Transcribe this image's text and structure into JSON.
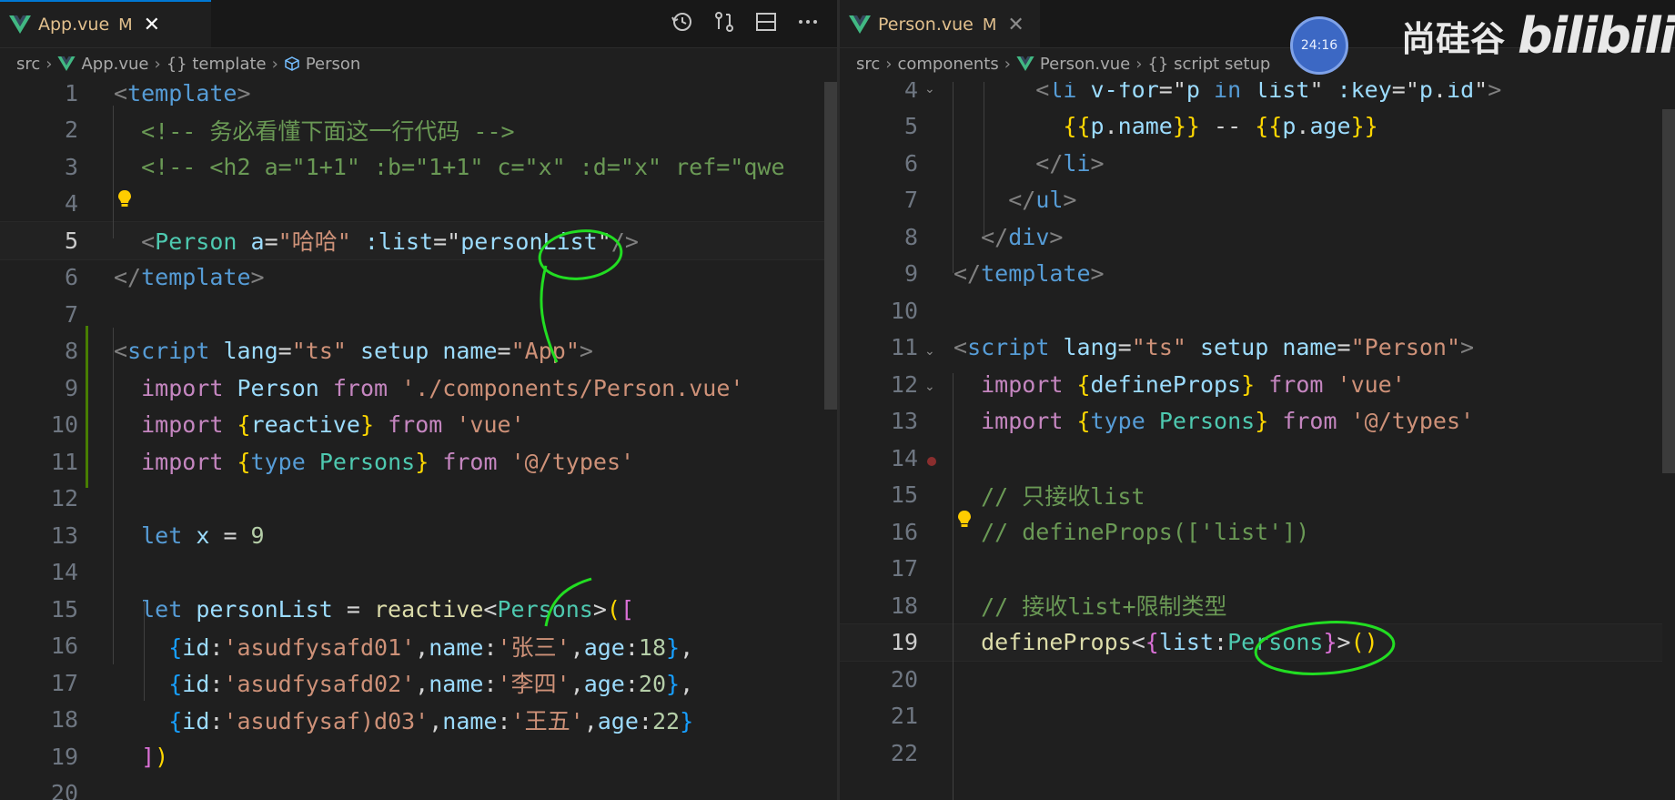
{
  "left": {
    "tab": {
      "name": "App.vue",
      "status": "M",
      "close": "✕"
    },
    "breadcrumb": [
      "src",
      "App.vue",
      "{} template",
      "Person"
    ],
    "lines": [
      {
        "n": "1",
        "tokens": [
          [
            "t-p",
            "<"
          ],
          [
            "t-tag",
            "template"
          ],
          [
            "t-p",
            ">"
          ]
        ]
      },
      {
        "n": "2",
        "tokens": [
          [
            "t-cmt",
            "  <!-- 务必看懂下面这一行代码 -->"
          ]
        ]
      },
      {
        "n": "3",
        "tokens": [
          [
            "t-cmt",
            "  <!-- <h2 a=\"1+1\" :b=\"1+1\" c=\"x\" :d=\"x\" ref=\"qwe"
          ]
        ]
      },
      {
        "n": "4",
        "tokens": []
      },
      {
        "n": "5",
        "tokens": [
          [
            "t-p",
            "  <"
          ],
          [
            "t-comp",
            "Person"
          ],
          [
            "t-op",
            " "
          ],
          [
            "t-attr",
            "a"
          ],
          [
            "t-op",
            "="
          ],
          [
            "t-str",
            "\"哈哈\""
          ],
          [
            "t-op",
            " "
          ],
          [
            "t-attr",
            ":list"
          ],
          [
            "t-op",
            "="
          ],
          [
            "t-op",
            "\""
          ],
          [
            "t-var",
            "personList"
          ],
          [
            "t-op",
            "\""
          ],
          [
            "t-p",
            "/>"
          ]
        ]
      },
      {
        "n": "6",
        "tokens": [
          [
            "t-p",
            "</"
          ],
          [
            "t-tag",
            "template"
          ],
          [
            "t-p",
            ">"
          ]
        ]
      },
      {
        "n": "7",
        "tokens": []
      },
      {
        "n": "8",
        "tokens": [
          [
            "t-p",
            "<"
          ],
          [
            "t-tag",
            "script"
          ],
          [
            "t-op",
            " "
          ],
          [
            "t-attr",
            "lang"
          ],
          [
            "t-op",
            "="
          ],
          [
            "t-str",
            "\"ts\""
          ],
          [
            "t-op",
            " "
          ],
          [
            "t-attr",
            "setup"
          ],
          [
            "t-op",
            " "
          ],
          [
            "t-attr",
            "name"
          ],
          [
            "t-op",
            "="
          ],
          [
            "t-str",
            "\"App\""
          ],
          [
            "t-p",
            ">"
          ]
        ]
      },
      {
        "n": "9",
        "tokens": [
          [
            "t-kw",
            "  import"
          ],
          [
            "t-op",
            " "
          ],
          [
            "t-var",
            "Person"
          ],
          [
            "t-op",
            " "
          ],
          [
            "t-kw",
            "from"
          ],
          [
            "t-op",
            " "
          ],
          [
            "t-str",
            "'./components/Person.vue'"
          ]
        ]
      },
      {
        "n": "10",
        "tokens": [
          [
            "t-kw",
            "  import"
          ],
          [
            "t-op",
            " "
          ],
          [
            "t-b1",
            "{"
          ],
          [
            "t-var",
            "reactive"
          ],
          [
            "t-b1",
            "}"
          ],
          [
            "t-op",
            " "
          ],
          [
            "t-kw",
            "from"
          ],
          [
            "t-op",
            " "
          ],
          [
            "t-str",
            "'vue'"
          ]
        ]
      },
      {
        "n": "11",
        "tokens": [
          [
            "t-kw",
            "  import"
          ],
          [
            "t-op",
            " "
          ],
          [
            "t-b1",
            "{"
          ],
          [
            "t-bkw",
            "type"
          ],
          [
            "t-op",
            " "
          ],
          [
            "t-type",
            "Persons"
          ],
          [
            "t-b1",
            "}"
          ],
          [
            "t-op",
            " "
          ],
          [
            "t-kw",
            "from"
          ],
          [
            "t-op",
            " "
          ],
          [
            "t-str",
            "'@/types'"
          ]
        ]
      },
      {
        "n": "12",
        "tokens": []
      },
      {
        "n": "13",
        "tokens": [
          [
            "t-bkw",
            "  let"
          ],
          [
            "t-op",
            " "
          ],
          [
            "t-var",
            "x"
          ],
          [
            "t-op",
            " = "
          ],
          [
            "t-num",
            "9"
          ]
        ]
      },
      {
        "n": "14",
        "tokens": []
      },
      {
        "n": "15",
        "tokens": [
          [
            "t-bkw",
            "  let"
          ],
          [
            "t-op",
            " "
          ],
          [
            "t-var",
            "personList"
          ],
          [
            "t-op",
            " = "
          ],
          [
            "t-fn",
            "reactive"
          ],
          [
            "t-op",
            "<"
          ],
          [
            "t-type",
            "Persons"
          ],
          [
            "t-op",
            ">"
          ],
          [
            "t-b1",
            "("
          ],
          [
            "t-b2",
            "["
          ]
        ]
      },
      {
        "n": "16",
        "tokens": [
          [
            "t-op",
            "    "
          ],
          [
            "t-b3",
            "{"
          ],
          [
            "t-var",
            "id"
          ],
          [
            "t-op",
            ":"
          ],
          [
            "t-str",
            "'asudfysafd01'"
          ],
          [
            "t-op",
            ","
          ],
          [
            "t-var",
            "name"
          ],
          [
            "t-op",
            ":"
          ],
          [
            "t-str",
            "'张三'"
          ],
          [
            "t-op",
            ","
          ],
          [
            "t-var",
            "age"
          ],
          [
            "t-op",
            ":"
          ],
          [
            "t-num",
            "18"
          ],
          [
            "t-b3",
            "}"
          ],
          [
            "t-op",
            ","
          ]
        ]
      },
      {
        "n": "17",
        "tokens": [
          [
            "t-op",
            "    "
          ],
          [
            "t-b3",
            "{"
          ],
          [
            "t-var",
            "id"
          ],
          [
            "t-op",
            ":"
          ],
          [
            "t-str",
            "'asudfysafd02'"
          ],
          [
            "t-op",
            ","
          ],
          [
            "t-var",
            "name"
          ],
          [
            "t-op",
            ":"
          ],
          [
            "t-str",
            "'李四'"
          ],
          [
            "t-op",
            ","
          ],
          [
            "t-var",
            "age"
          ],
          [
            "t-op",
            ":"
          ],
          [
            "t-num",
            "20"
          ],
          [
            "t-b3",
            "}"
          ],
          [
            "t-op",
            ","
          ]
        ]
      },
      {
        "n": "18",
        "tokens": [
          [
            "t-op",
            "    "
          ],
          [
            "t-b3",
            "{"
          ],
          [
            "t-var",
            "id"
          ],
          [
            "t-op",
            ":"
          ],
          [
            "t-str",
            "'asudfysaf)d03'"
          ],
          [
            "t-op",
            ","
          ],
          [
            "t-var",
            "name"
          ],
          [
            "t-op",
            ":"
          ],
          [
            "t-str",
            "'王五'"
          ],
          [
            "t-op",
            ","
          ],
          [
            "t-var",
            "age"
          ],
          [
            "t-op",
            ":"
          ],
          [
            "t-num",
            "22"
          ],
          [
            "t-b3",
            "}"
          ]
        ]
      },
      {
        "n": "19",
        "tokens": [
          [
            "t-op",
            "  "
          ],
          [
            "t-b2",
            "]"
          ],
          [
            "t-b1",
            ")"
          ]
        ]
      },
      {
        "n": "20",
        "tokens": []
      }
    ]
  },
  "right": {
    "tab": {
      "name": "Person.vue",
      "status": "M",
      "close": "✕"
    },
    "breadcrumb": [
      "src",
      "components",
      "Person.vue",
      "{} script setup"
    ],
    "lines": [
      {
        "n": "4",
        "tokens": [
          [
            "t-p",
            "      <"
          ],
          [
            "t-tag",
            "li"
          ],
          [
            "t-op",
            " "
          ],
          [
            "t-attr",
            "v-for"
          ],
          [
            "t-op",
            "="
          ],
          [
            "t-op",
            "\""
          ],
          [
            "t-var",
            "p"
          ],
          [
            "t-op",
            " "
          ],
          [
            "t-bkw",
            "in"
          ],
          [
            "t-op",
            " "
          ],
          [
            "t-var",
            "list"
          ],
          [
            "t-op",
            "\""
          ],
          [
            "t-op",
            " "
          ],
          [
            "t-attr",
            ":key"
          ],
          [
            "t-op",
            "="
          ],
          [
            "t-op",
            "\""
          ],
          [
            "t-var",
            "p"
          ],
          [
            "t-op",
            "."
          ],
          [
            "t-var",
            "id"
          ],
          [
            "t-op",
            "\""
          ],
          [
            "t-p",
            ">"
          ]
        ]
      },
      {
        "n": "5",
        "tokens": [
          [
            "t-op",
            "        "
          ],
          [
            "t-b1",
            "{{"
          ],
          [
            "t-var",
            "p"
          ],
          [
            "t-op",
            "."
          ],
          [
            "t-var",
            "name"
          ],
          [
            "t-b1",
            "}}"
          ],
          [
            "t-op",
            " -- "
          ],
          [
            "t-b1",
            "{{"
          ],
          [
            "t-var",
            "p"
          ],
          [
            "t-op",
            "."
          ],
          [
            "t-var",
            "age"
          ],
          [
            "t-b1",
            "}}"
          ]
        ]
      },
      {
        "n": "6",
        "tokens": [
          [
            "t-p",
            "      </"
          ],
          [
            "t-tag",
            "li"
          ],
          [
            "t-p",
            ">"
          ]
        ]
      },
      {
        "n": "7",
        "tokens": [
          [
            "t-p",
            "    </"
          ],
          [
            "t-tag",
            "ul"
          ],
          [
            "t-p",
            ">"
          ]
        ]
      },
      {
        "n": "8",
        "tokens": [
          [
            "t-p",
            "  </"
          ],
          [
            "t-tag",
            "div"
          ],
          [
            "t-p",
            ">"
          ]
        ]
      },
      {
        "n": "9",
        "tokens": [
          [
            "t-p",
            "</"
          ],
          [
            "t-tag",
            "template"
          ],
          [
            "t-p",
            ">"
          ]
        ]
      },
      {
        "n": "10",
        "tokens": []
      },
      {
        "n": "11",
        "tokens": [
          [
            "t-p",
            "<"
          ],
          [
            "t-tag",
            "script"
          ],
          [
            "t-op",
            " "
          ],
          [
            "t-attr",
            "lang"
          ],
          [
            "t-op",
            "="
          ],
          [
            "t-str",
            "\"ts\""
          ],
          [
            "t-op",
            " "
          ],
          [
            "t-attr",
            "setup"
          ],
          [
            "t-op",
            " "
          ],
          [
            "t-attr",
            "name"
          ],
          [
            "t-op",
            "="
          ],
          [
            "t-str",
            "\"Person\""
          ],
          [
            "t-p",
            ">"
          ]
        ]
      },
      {
        "n": "12",
        "tokens": [
          [
            "t-kw",
            "  import"
          ],
          [
            "t-op",
            " "
          ],
          [
            "t-b1",
            "{"
          ],
          [
            "t-var",
            "defineProps"
          ],
          [
            "t-b1",
            "}"
          ],
          [
            "t-op",
            " "
          ],
          [
            "t-kw",
            "from"
          ],
          [
            "t-op",
            " "
          ],
          [
            "t-str",
            "'vue'"
          ]
        ]
      },
      {
        "n": "13",
        "tokens": [
          [
            "t-kw",
            "  import"
          ],
          [
            "t-op",
            " "
          ],
          [
            "t-b1",
            "{"
          ],
          [
            "t-bkw",
            "type"
          ],
          [
            "t-op",
            " "
          ],
          [
            "t-type",
            "Persons"
          ],
          [
            "t-b1",
            "}"
          ],
          [
            "t-op",
            " "
          ],
          [
            "t-kw",
            "from"
          ],
          [
            "t-op",
            " "
          ],
          [
            "t-str",
            "'@/types'"
          ]
        ]
      },
      {
        "n": "14",
        "tokens": []
      },
      {
        "n": "15",
        "tokens": [
          [
            "t-cmt",
            "  // 只接收list"
          ]
        ]
      },
      {
        "n": "16",
        "tokens": [
          [
            "t-cmt",
            "  // defineProps(['list'])"
          ]
        ]
      },
      {
        "n": "17",
        "tokens": []
      },
      {
        "n": "18",
        "tokens": [
          [
            "t-cmt",
            "  // 接收list+限制类型"
          ]
        ]
      },
      {
        "n": "19",
        "tokens": [
          [
            "t-op",
            "  "
          ],
          [
            "t-fn",
            "defineProps"
          ],
          [
            "t-op",
            "<"
          ],
          [
            "t-b2",
            "{"
          ],
          [
            "t-var",
            "list"
          ],
          [
            "t-op",
            ":"
          ],
          [
            "t-type",
            "Persons"
          ],
          [
            "t-b2",
            "}"
          ],
          [
            "t-op",
            ">"
          ],
          [
            "t-b1",
            "()"
          ]
        ]
      },
      {
        "n": "20",
        "tokens": []
      },
      {
        "n": "21",
        "tokens": []
      },
      {
        "n": "22",
        "tokens": []
      }
    ]
  },
  "overlay": {
    "timer": "24:16",
    "brand_text": "尚硅谷",
    "brand_logo": "bilibili"
  },
  "colors": {
    "tab_modified": "#e2c08d",
    "accent": "#0078d4",
    "vue_green": "#41b883",
    "annotation": "#22dd22"
  }
}
